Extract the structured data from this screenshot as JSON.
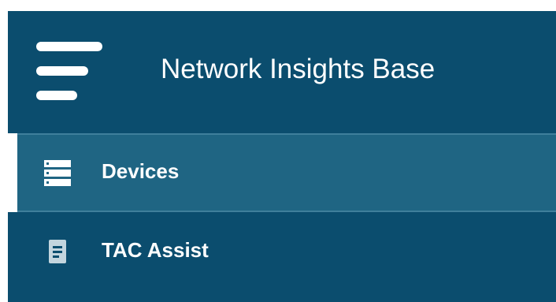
{
  "header": {
    "title": "Network Insights Base",
    "menu_icon": "hamburger-menu-icon"
  },
  "nav": {
    "items": [
      {
        "label": "Devices",
        "icon": "server-stack-icon",
        "active": true
      },
      {
        "label": "TAC Assist",
        "icon": "document-icon",
        "active": false
      }
    ]
  },
  "colors": {
    "panel_bg": "#0b4d6e",
    "active_item_bg": "#1f6583",
    "active_accent": "#ffffff",
    "text": "#ffffff"
  }
}
